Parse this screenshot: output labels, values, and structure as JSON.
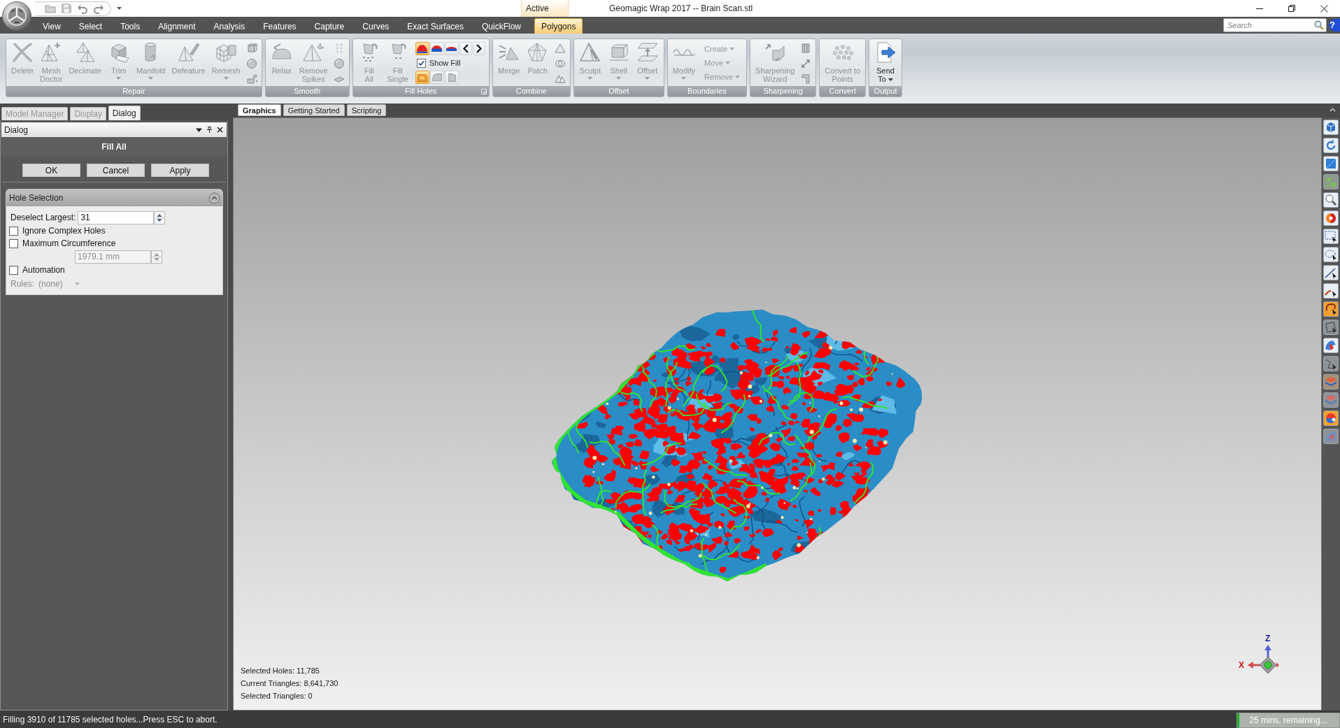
{
  "window": {
    "title": "Geomagic Wrap 2017 -- Brain Scan.stl",
    "context_header": "Active"
  },
  "menu_tabs": [
    {
      "label": "View",
      "selected": false
    },
    {
      "label": "Select",
      "selected": false
    },
    {
      "label": "Tools",
      "selected": false
    },
    {
      "label": "Alignment",
      "selected": false
    },
    {
      "label": "Analysis",
      "selected": false
    },
    {
      "label": "Features",
      "selected": false
    },
    {
      "label": "Capture",
      "selected": false
    },
    {
      "label": "Curves",
      "selected": false
    },
    {
      "label": "Exact Surfaces",
      "selected": false
    },
    {
      "label": "QuickFlow",
      "selected": false
    },
    {
      "label": "Polygons",
      "selected": true
    }
  ],
  "search": {
    "placeholder": "Search"
  },
  "help": "?",
  "ribbon_groups": [
    {
      "title": "Repair",
      "dialog_launcher": false,
      "items": [
        {
          "kind": "large",
          "label": "Delete",
          "disabled": true,
          "dropdown": false
        },
        {
          "kind": "large",
          "label": "Mesh\nDoctor",
          "disabled": true,
          "dropdown": false
        },
        {
          "kind": "large",
          "label": "Decimate",
          "disabled": true,
          "dropdown": false
        },
        {
          "kind": "large",
          "label": "Trim",
          "disabled": true,
          "dropdown": true
        },
        {
          "kind": "large",
          "label": "Manifold",
          "disabled": true,
          "dropdown": true
        },
        {
          "kind": "large",
          "label": "Defeature",
          "disabled": true,
          "dropdown": false
        },
        {
          "kind": "large",
          "label": "Remesh",
          "disabled": true,
          "dropdown": true
        },
        {
          "kind": "icon_stack"
        }
      ]
    },
    {
      "title": "Smooth",
      "dialog_launcher": false,
      "items": [
        {
          "kind": "large",
          "label": "Relax",
          "disabled": true,
          "dropdown": false
        },
        {
          "kind": "large",
          "label": "Remove\nSpikes",
          "disabled": true,
          "dropdown": false
        },
        {
          "kind": "icon_stack"
        }
      ]
    },
    {
      "title": "Fill Holes",
      "dialog_launcher": true,
      "items": [
        {
          "kind": "large",
          "label": "Fill\nAll",
          "disabled": true,
          "dropdown": false
        },
        {
          "kind": "large",
          "label": "Fill\nSingle",
          "disabled": true,
          "dropdown": false
        },
        {
          "kind": "fill_options",
          "modes": [
            {
              "selected": true
            },
            {
              "selected": false
            },
            {
              "selected": false
            }
          ],
          "show_fill": {
            "label": "Show Fill",
            "checked": true
          },
          "types": [
            {
              "selected": true
            },
            {
              "selected": false
            },
            {
              "selected": false
            }
          ]
        }
      ]
    },
    {
      "title": "Combine",
      "dialog_launcher": false,
      "items": [
        {
          "kind": "large",
          "label": "Merge",
          "disabled": true,
          "dropdown": false
        },
        {
          "kind": "large",
          "label": "Patch",
          "disabled": true,
          "dropdown": false
        },
        {
          "kind": "icon_stack"
        }
      ]
    },
    {
      "title": "Offset",
      "dialog_launcher": false,
      "items": [
        {
          "kind": "large",
          "label": "Sculpt",
          "disabled": true,
          "dropdown": true
        },
        {
          "kind": "large",
          "label": "Shell",
          "disabled": true,
          "dropdown": true
        },
        {
          "kind": "large",
          "label": "Offset",
          "disabled": true,
          "dropdown": true
        }
      ]
    },
    {
      "title": "Boundaries",
      "dialog_launcher": false,
      "items": [
        {
          "kind": "large",
          "label": "Modify",
          "disabled": true,
          "dropdown": true
        },
        {
          "kind": "small_stack",
          "entries": [
            {
              "label": "Create",
              "disabled": true,
              "dropdown": true
            },
            {
              "label": "Move",
              "disabled": true,
              "dropdown": true
            },
            {
              "label": "Remove",
              "disabled": true,
              "dropdown": true
            }
          ]
        }
      ]
    },
    {
      "title": "Sharpening",
      "dialog_launcher": false,
      "items": [
        {
          "kind": "large",
          "label": "Sharpening\nWizard",
          "disabled": true,
          "dropdown": false
        },
        {
          "kind": "icon_stack"
        }
      ]
    },
    {
      "title": "Convert",
      "dialog_launcher": false,
      "items": [
        {
          "kind": "large",
          "label": "Convert to\nPoints",
          "disabled": true,
          "dropdown": false
        }
      ]
    },
    {
      "title": "Output",
      "dialog_launcher": false,
      "items": [
        {
          "kind": "large",
          "label": "Send\nTo",
          "disabled": false,
          "dropdown": true
        }
      ]
    }
  ],
  "panel_tabs": [
    {
      "label": "Model Manager",
      "selected": false
    },
    {
      "label": "Display",
      "selected": false
    },
    {
      "label": "Dialog",
      "selected": true
    }
  ],
  "dialog": {
    "title": "Dialog",
    "command": "Fill All",
    "buttons": [
      "OK",
      "Cancel",
      "Apply"
    ],
    "section": {
      "title": "Hole Selection",
      "expanded": true,
      "rows": [
        {
          "kind": "spin",
          "label": "Deselect Largest:",
          "value": "31",
          "disabled": false
        },
        {
          "kind": "check",
          "label": "Ignore Complex Holes",
          "checked": false
        },
        {
          "kind": "check",
          "label": "Maximum Circumference",
          "checked": false
        },
        {
          "kind": "spin",
          "value": "1979.1 mm",
          "disabled": true
        },
        {
          "kind": "check",
          "label": "Automation",
          "checked": false
        },
        {
          "kind": "select",
          "label": "Rules:",
          "value": "(none)",
          "disabled": true
        }
      ]
    }
  },
  "view_tabs": [
    {
      "label": "Graphics",
      "selected": true
    },
    {
      "label": "Getting Started",
      "selected": false
    },
    {
      "label": "Scripting",
      "selected": false
    }
  ],
  "viewport": {
    "stats": [
      "Selected Holes: 11,785",
      "Current Triangles: 8,641,730",
      "Selected Triangles: 0"
    ],
    "axes": {
      "x": "X",
      "z": "Z"
    }
  },
  "status_bar": {
    "message": "Filling 3910 of 11785 selected holes...Press ESC to abort.",
    "progress": {
      "label": "25 mins. remaining...",
      "level": 0.02
    }
  }
}
